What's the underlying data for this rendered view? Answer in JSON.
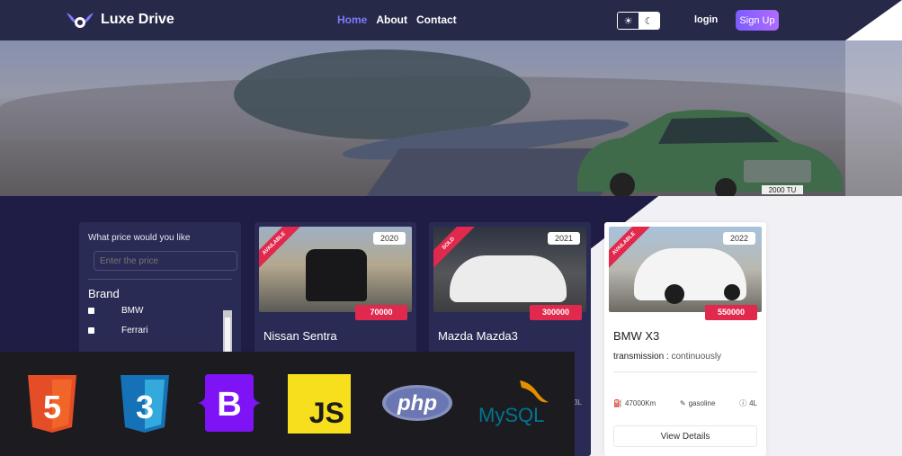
{
  "nav": {
    "brand": "Luxe Drive",
    "links": [
      "Home",
      "About",
      "Contact"
    ],
    "login": "login",
    "signup": "Sign Up"
  },
  "filter": {
    "question": "What price would you like",
    "price_placeholder": "Enter the price",
    "brand_heading": "Brand",
    "brands": [
      "BMW",
      "Ferrari"
    ]
  },
  "cards": [
    {
      "status": "AVAILABLE",
      "year": "2020",
      "price": "70000",
      "name": "Nissan Sentra",
      "spec_tail": ""
    },
    {
      "status": "SOLD",
      "year": "2021",
      "price": "300000",
      "name": "Mazda Mazda3",
      "spec_tail": "3L"
    },
    {
      "status": "AVAILABLE",
      "year": "2022",
      "price": "550000",
      "name": "BMW X3",
      "transmission_label": "transmission :",
      "transmission_value": "continuously",
      "mileage": "47000Km",
      "fuel": "gasoline",
      "engine": "4L",
      "details": "View Details"
    }
  ],
  "tech": {
    "html": "5",
    "css": "3",
    "bootstrap": "B",
    "js": "JS",
    "php": "php",
    "mysql": "MySQL"
  },
  "colors": {
    "nav_bg": "#262a48",
    "accent": "#7d79ff",
    "badge_red": "#e0294d",
    "page_dark": "#1f1c45"
  }
}
